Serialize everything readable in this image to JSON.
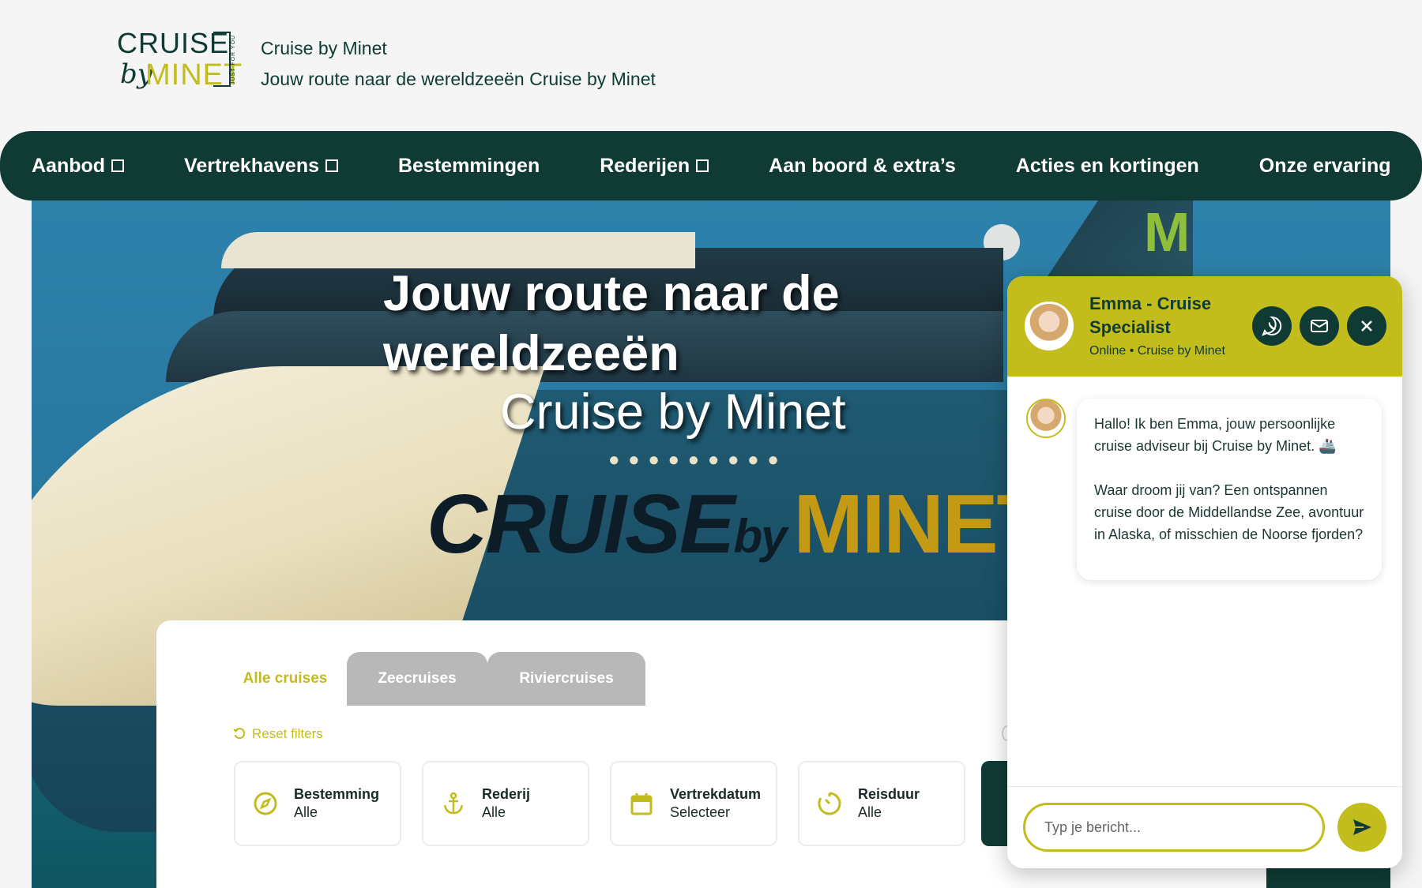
{
  "brand": {
    "logo_word1": "CRUISE",
    "logo_by": "by",
    "logo_word2": "MINET",
    "logo_tag": "JUST FOR YOU",
    "site_title": "Cruise by Minet",
    "tagline": "Jouw route naar de wereldzeeën Cruise by Minet"
  },
  "nav": {
    "items": [
      {
        "label": "Aanbod",
        "has_box": true
      },
      {
        "label": "Vertrekhavens",
        "has_box": true
      },
      {
        "label": "Bestemmingen",
        "has_box": false
      },
      {
        "label": "Rederijen",
        "has_box": true
      },
      {
        "label": "Aan boord & extra’s",
        "has_box": false
      },
      {
        "label": "Acties en kortingen",
        "has_box": false
      },
      {
        "label": "Onze ervaring",
        "has_box": false
      }
    ]
  },
  "hero": {
    "title": "Jouw route naar de wereldzeeën",
    "subtitle": "Cruise by Minet",
    "ship_brand_1": "CRUISE",
    "ship_brand_by": "by",
    "ship_brand_2": "MINET",
    "funnel_letter": "M"
  },
  "search": {
    "tabs": [
      "Alle cruises",
      "Zeecruises",
      "Riviercruises"
    ],
    "active_tab": "Alle cruises",
    "reset_label": "Reset filters",
    "filters": [
      {
        "icon": "compass-icon",
        "label": "Bestemming",
        "value": "Alle"
      },
      {
        "icon": "anchor-icon",
        "label": "Rederij",
        "value": "Alle"
      },
      {
        "icon": "calendar-icon",
        "label": "Vertrekdatum",
        "value": "Selecteer"
      },
      {
        "icon": "timer-icon",
        "label": "Reisduur",
        "value": "Alle"
      }
    ]
  },
  "chat": {
    "agent_name": "Emma - Cruise Specialist",
    "status": "Online • Cruise by Minet",
    "message": "Hallo! Ik ben Emma, jouw persoonlijke cruise adviseur bij Cruise by Minet. 🚢\n\nWaar droom jij van? Een ontspannen cruise door de Middellandse Zee, avontuur in Alaska, of misschien de Noorse fjorden?",
    "input_placeholder": "Typ je bericht...",
    "icons": [
      "whatsapp-icon",
      "mail-icon",
      "close-icon",
      "send-icon"
    ]
  },
  "colors": {
    "primary": "#0f3b34",
    "accent": "#c2bc1d",
    "background": "#f4f5f4",
    "tab_inactive": "#b8b8b8"
  }
}
